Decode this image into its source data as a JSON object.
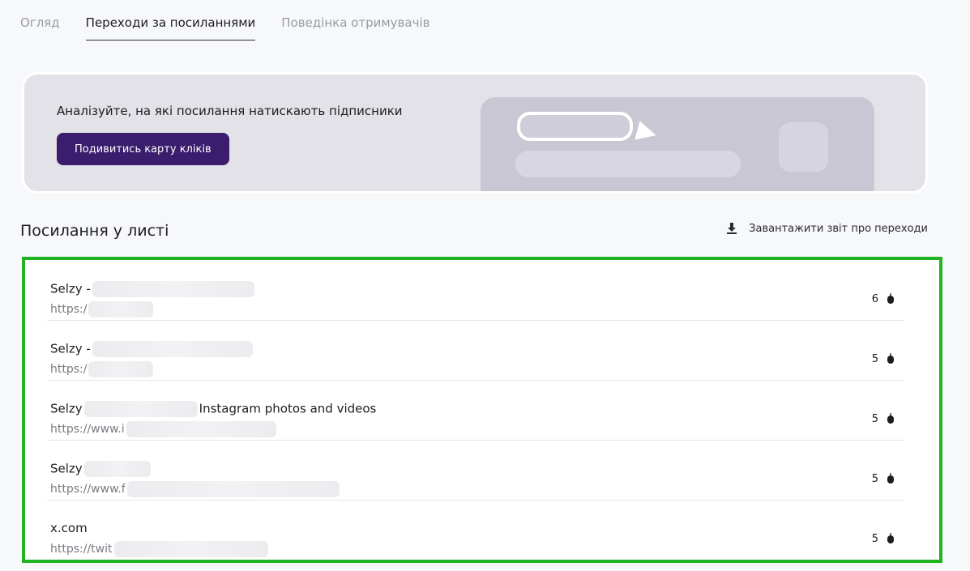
{
  "tabs": [
    {
      "label": "Огляд"
    },
    {
      "label": "Переходи за посиланнями"
    },
    {
      "label": "Поведінка отримувачів"
    }
  ],
  "banner": {
    "text": "Аналізуйте, на які посилання натискають підписники",
    "button_label": "Подивитись карту кліків"
  },
  "section": {
    "title": "Посилання у листі",
    "download_label": "Завантажити звіт про переходи"
  },
  "links": [
    {
      "title": "Selzy -",
      "title_suffix": "",
      "url": "https:/",
      "clicks": "6"
    },
    {
      "title": "Selzy -",
      "title_suffix": "",
      "url": "https:/",
      "clicks": "5"
    },
    {
      "title": "Selzy",
      "title_suffix": "Instagram photos and videos",
      "url": "https://www.i",
      "clicks": "5"
    },
    {
      "title": "Selzy",
      "title_suffix": "",
      "url": "https://www.f",
      "clicks": "5"
    },
    {
      "title": "x.com",
      "title_suffix": "",
      "url": "https://twit",
      "clicks": "5"
    }
  ],
  "colors": {
    "accent_button": "#3b1d6e",
    "highlight_border": "#22b322"
  },
  "icons": {
    "download": "download-icon",
    "clicks": "mouse-icon"
  }
}
